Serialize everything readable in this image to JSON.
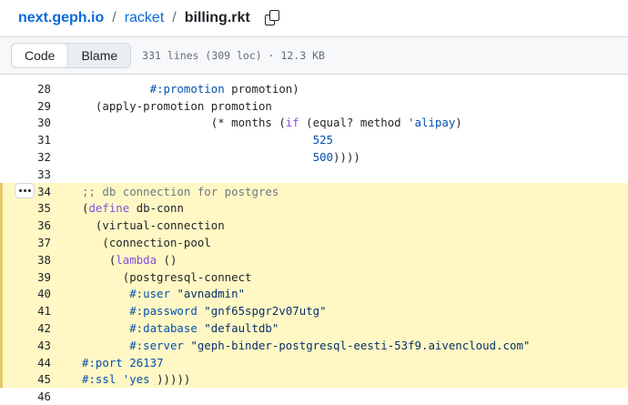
{
  "breadcrumb": {
    "repo": "next.geph.io",
    "sep1": "/",
    "folder": "racket",
    "sep2": "/",
    "file": "billing.rkt"
  },
  "toolbar": {
    "code_label": "Code",
    "blame_label": "Blame",
    "file_info": "331 lines (309 loc) · 12.3 KB"
  },
  "colors": {
    "link": "#0969da",
    "keyword": "#8250df",
    "number": "#0550ae",
    "string": "#0a3069",
    "comment": "#6e7781",
    "highlight": "#fff8c5"
  },
  "lines": [
    {
      "n": "28",
      "hl": false,
      "tokens": [
        [
          "p",
          "          "
        ],
        [
          "n",
          "#:promotion"
        ],
        [
          "p",
          " promotion)"
        ]
      ]
    },
    {
      "n": "29",
      "hl": false,
      "tokens": [
        [
          "p",
          "  (apply-promotion promotion"
        ]
      ]
    },
    {
      "n": "30",
      "hl": false,
      "tokens": [
        [
          "p",
          "                   (* months ("
        ],
        [
          "k",
          "if"
        ],
        [
          "p",
          " (equal? method "
        ],
        [
          "n",
          "'alipay"
        ],
        [
          "p",
          ")"
        ]
      ]
    },
    {
      "n": "31",
      "hl": false,
      "tokens": [
        [
          "p",
          "                                  "
        ],
        [
          "n",
          "525"
        ]
      ]
    },
    {
      "n": "32",
      "hl": false,
      "tokens": [
        [
          "p",
          "                                  "
        ],
        [
          "n",
          "500"
        ],
        [
          "p",
          "))))"
        ]
      ]
    },
    {
      "n": "33",
      "hl": false,
      "tokens": []
    },
    {
      "n": "34",
      "hl": true,
      "dots": true,
      "tokens": [
        [
          "c",
          ";; db connection for postgres"
        ]
      ]
    },
    {
      "n": "35",
      "hl": true,
      "tokens": [
        [
          "p",
          "("
        ],
        [
          "k",
          "define"
        ],
        [
          "p",
          " db-conn"
        ]
      ]
    },
    {
      "n": "36",
      "hl": true,
      "tokens": [
        [
          "p",
          "  (virtual-connection"
        ]
      ]
    },
    {
      "n": "37",
      "hl": true,
      "tokens": [
        [
          "p",
          "   (connection-pool"
        ]
      ]
    },
    {
      "n": "38",
      "hl": true,
      "tokens": [
        [
          "p",
          "    ("
        ],
        [
          "k",
          "lambda"
        ],
        [
          "p",
          " ()"
        ]
      ]
    },
    {
      "n": "39",
      "hl": true,
      "tokens": [
        [
          "p",
          "      (postgresql-connect"
        ]
      ]
    },
    {
      "n": "40",
      "hl": true,
      "tokens": [
        [
          "p",
          "       "
        ],
        [
          "n",
          "#:user"
        ],
        [
          "p",
          " "
        ],
        [
          "s",
          "\"avnadmin\""
        ]
      ]
    },
    {
      "n": "41",
      "hl": true,
      "tokens": [
        [
          "p",
          "       "
        ],
        [
          "n",
          "#:password"
        ],
        [
          "p",
          " "
        ],
        [
          "s",
          "\"gnf65spgr2v07utg\""
        ]
      ]
    },
    {
      "n": "42",
      "hl": true,
      "tokens": [
        [
          "p",
          "       "
        ],
        [
          "n",
          "#:database"
        ],
        [
          "p",
          " "
        ],
        [
          "s",
          "\"defaultdb\""
        ]
      ]
    },
    {
      "n": "43",
      "hl": true,
      "tokens": [
        [
          "p",
          "       "
        ],
        [
          "n",
          "#:server"
        ],
        [
          "p",
          " "
        ],
        [
          "s",
          "\"geph-binder-postgresql-eesti-53f9.aivencloud.com\""
        ]
      ]
    },
    {
      "n": "44",
      "hl": true,
      "tokens": [
        [
          "n",
          "#:port"
        ],
        [
          "p",
          " "
        ],
        [
          "n",
          "26137"
        ]
      ]
    },
    {
      "n": "45",
      "hl": true,
      "tokens": [
        [
          "n",
          "#:ssl"
        ],
        [
          "p",
          " "
        ],
        [
          "n",
          "'yes"
        ],
        [
          "p",
          " )))))"
        ]
      ]
    },
    {
      "n": "46",
      "hl": false,
      "tokens": []
    }
  ]
}
